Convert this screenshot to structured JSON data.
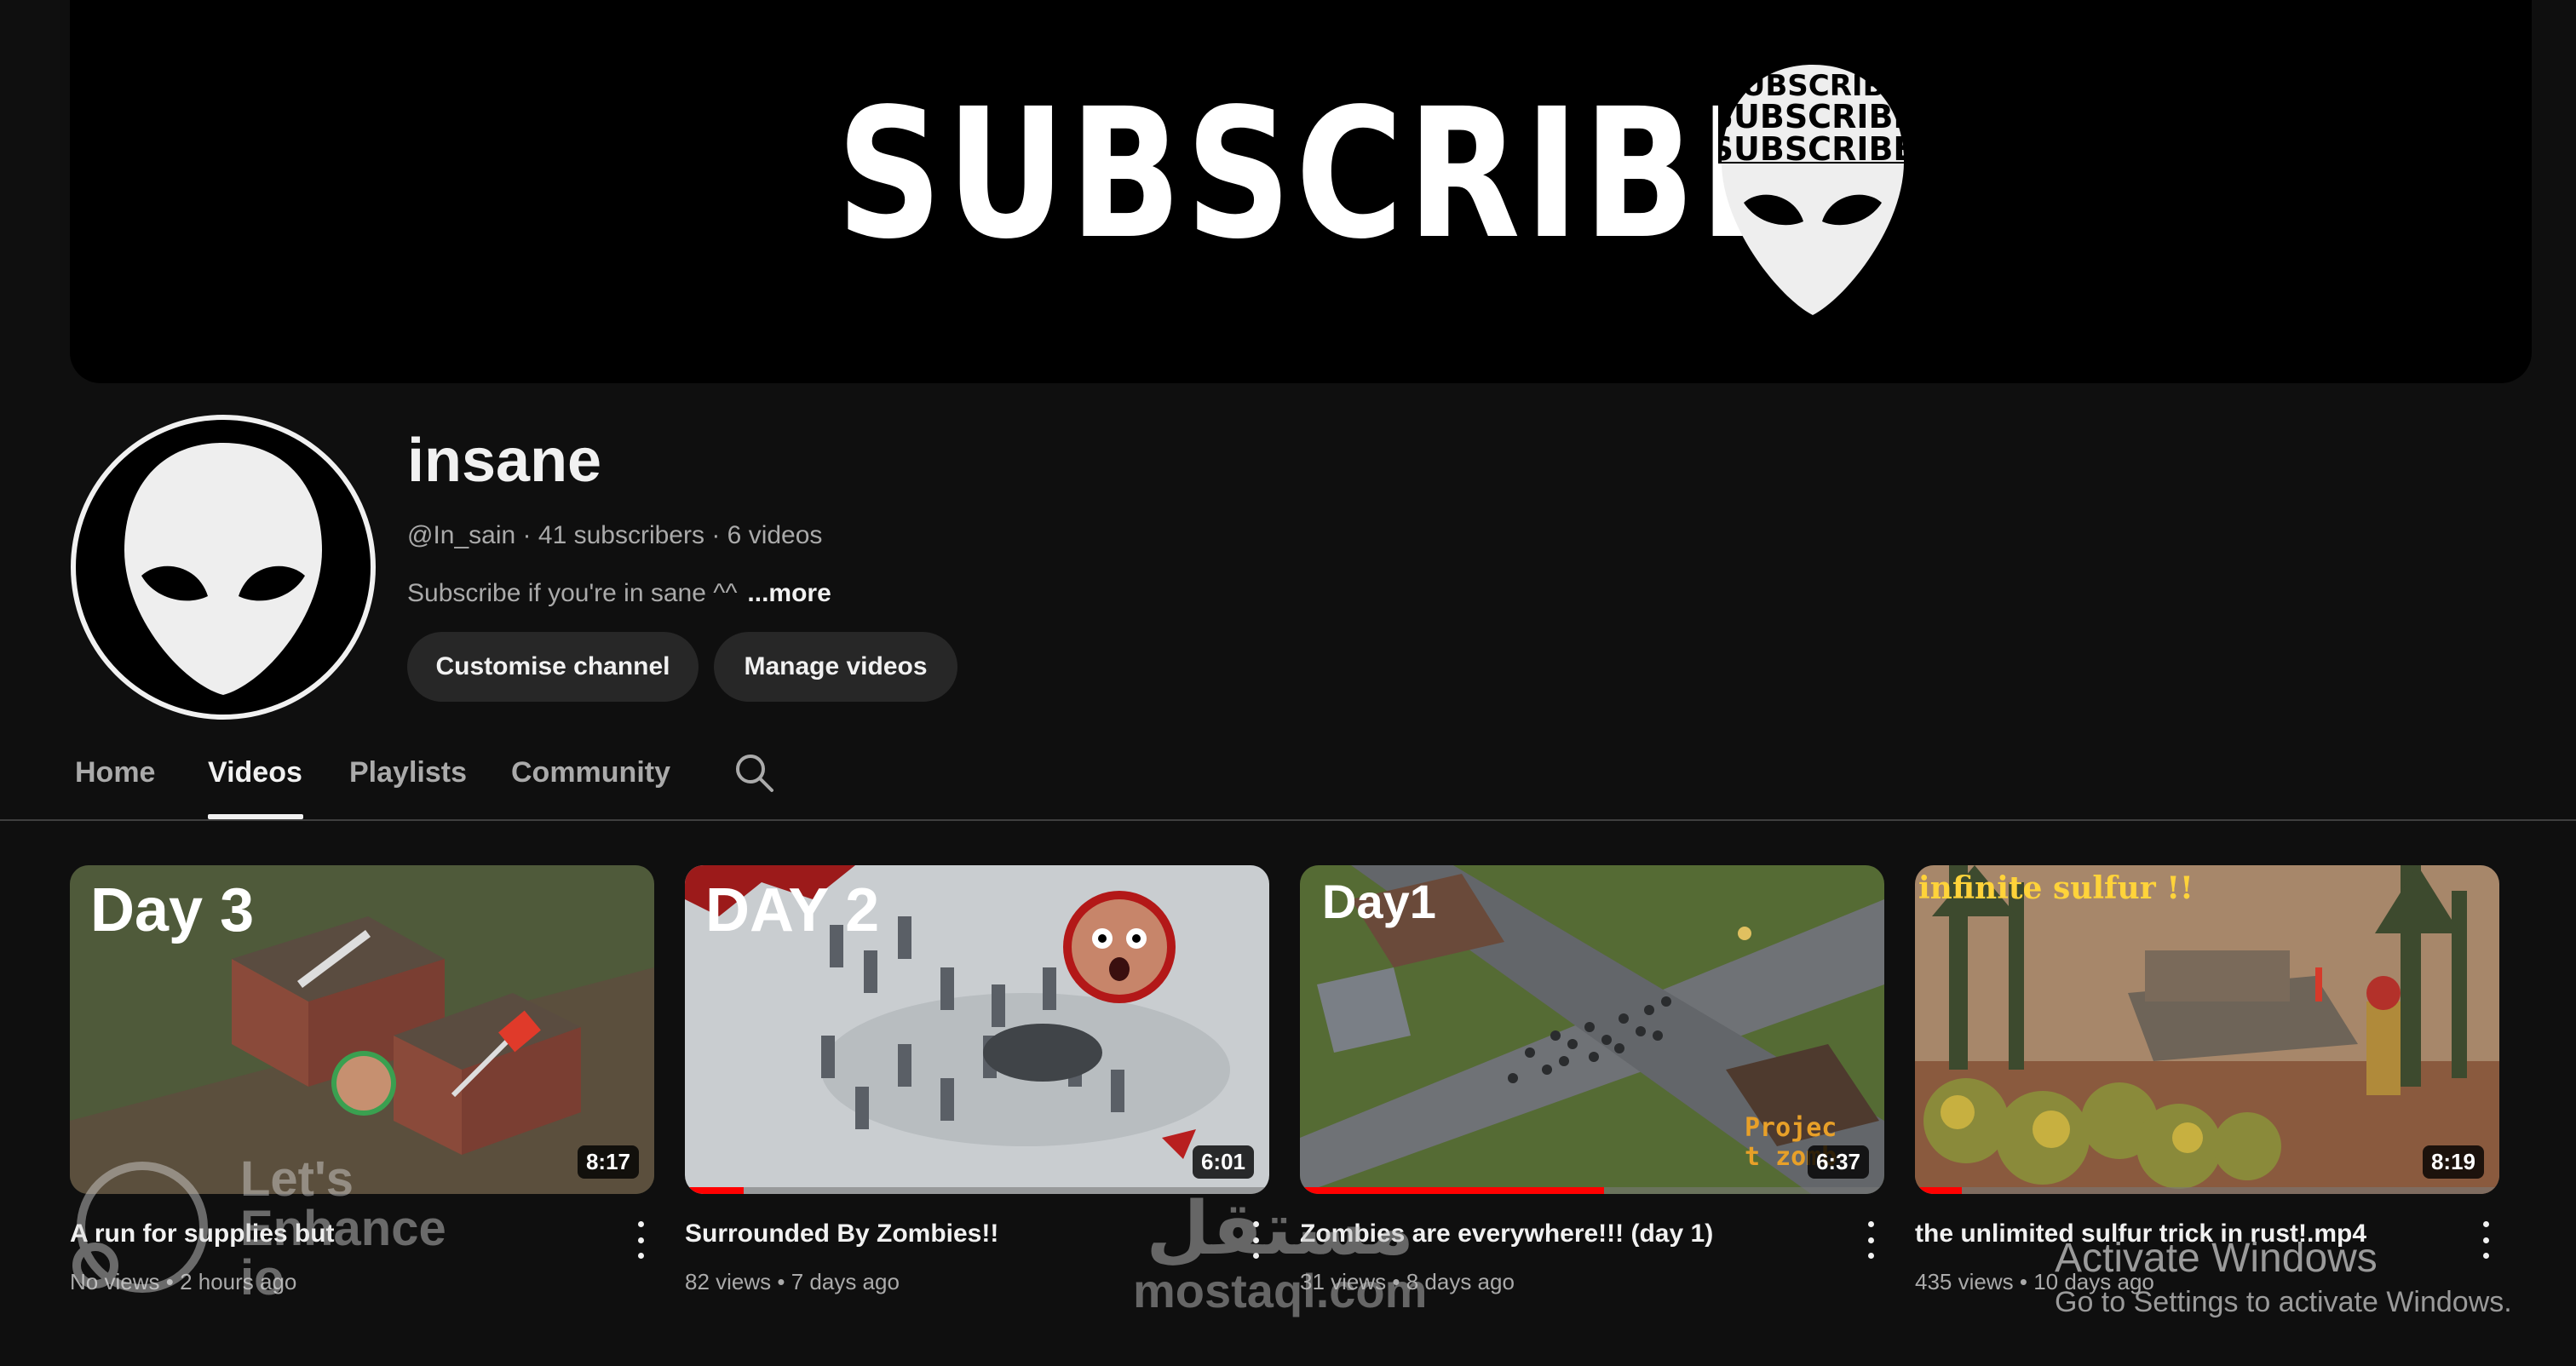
{
  "banner": {
    "text": "SUBSCRIBE",
    "alien_words": [
      "SUBSCRIBE",
      "SUBSCRIBE",
      "SUBSCRIBE"
    ]
  },
  "channel": {
    "name": "insane",
    "handle": "@In_sain",
    "subscribers": "41 subscribers",
    "videos_count": "6 videos",
    "separator": "·",
    "description": "Subscribe if you're in sane ^^",
    "more_label": "...more"
  },
  "buttons": {
    "customise": "Customise channel",
    "manage": "Manage videos"
  },
  "tabs": [
    {
      "label": "Home",
      "active": false
    },
    {
      "label": "Videos",
      "active": true
    },
    {
      "label": "Playlists",
      "active": false
    },
    {
      "label": "Community",
      "active": false
    }
  ],
  "videos": [
    {
      "thumb_text": "Day 3",
      "duration": "8:17",
      "title": "A run for supplies but",
      "views": "No views",
      "age": "2 hours ago",
      "progress": 0
    },
    {
      "thumb_text": "DAY 2",
      "duration": "6:01",
      "title": "Surrounded By Zombies!!",
      "views": "82 views",
      "age": "7 days ago",
      "progress": 0.1
    },
    {
      "thumb_text": "Day1",
      "duration": "6:37",
      "title": "Zombies are everywhere!!! (day 1)",
      "views": "31 views",
      "age": "8 days ago",
      "progress": 0.52,
      "corner_text": "Project zomb"
    },
    {
      "thumb_text": "infinite sulfur !!",
      "duration": "8:19",
      "title": "the unlimited sulfur trick in rust!.mp4",
      "views": "435 views",
      "age": "10 days ago",
      "progress": 0.08
    }
  ],
  "meta_separator": "•",
  "watermarks": {
    "enhance": [
      "Let's",
      "Enhance",
      "io"
    ],
    "mostaql_ar": "مستقل",
    "mostaql_en": "mostaql.com",
    "windows_line1": "Activate Windows",
    "windows_line2": "Go to Settings to activate Windows."
  }
}
